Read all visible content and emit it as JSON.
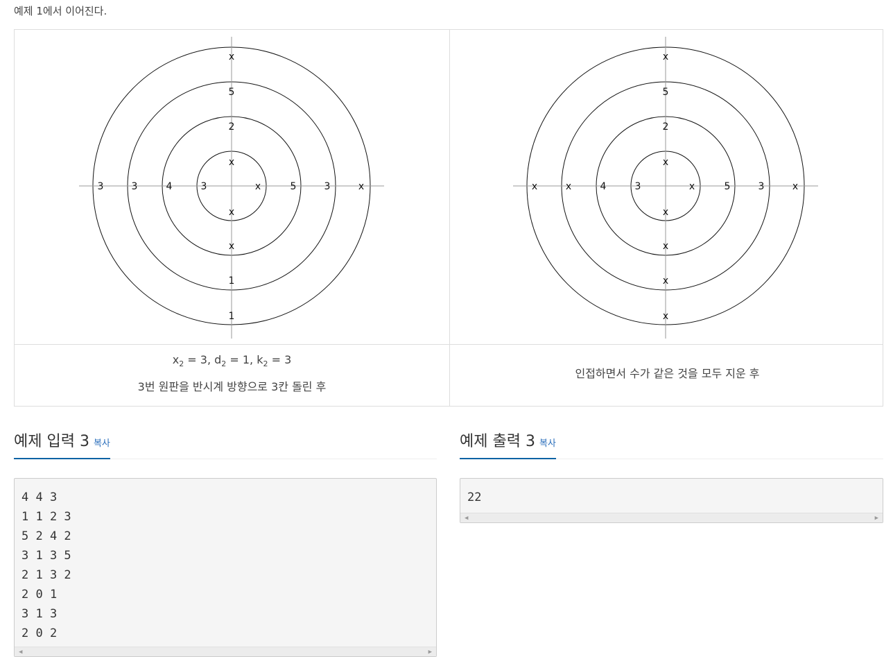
{
  "intro": "예제 1에서 이어진다.",
  "figures": {
    "left": {
      "vertical": [
        "x",
        "5",
        "2",
        "x",
        "x",
        "x",
        "1",
        "1"
      ],
      "horizontal": [
        "3",
        "3",
        "4",
        "3",
        "x",
        "5",
        "3",
        "x"
      ]
    },
    "right": {
      "vertical": [
        "x",
        "5",
        "2",
        "x",
        "x",
        "x",
        "x",
        "x"
      ],
      "horizontal": [
        "x",
        "x",
        "4",
        "3",
        "x",
        "5",
        "3",
        "x"
      ]
    }
  },
  "captions": {
    "left": {
      "x": "x",
      "x_sub": "2",
      "x_val": " = 3, ",
      "d": "d",
      "d_sub": "2",
      "d_val": " = 1, ",
      "k": "k",
      "k_sub": "2",
      "k_val": " = 3",
      "line2": "3번 원판을 반시계 방향으로 3칸 돌린 후"
    },
    "right": "인접하면서 수가 같은 것을 모두 지운 후"
  },
  "sample_input": {
    "title": "예제 입력 3",
    "copy_label": "복사",
    "lines": [
      "4 4 3",
      "1 1 2 3",
      "5 2 4 2",
      "3 1 3 5",
      "2 1 3 2",
      "2 0 1",
      "3 1 3",
      "2 0 2"
    ]
  },
  "sample_output": {
    "title": "예제 출력 3",
    "copy_label": "복사",
    "lines": [
      "22"
    ]
  }
}
